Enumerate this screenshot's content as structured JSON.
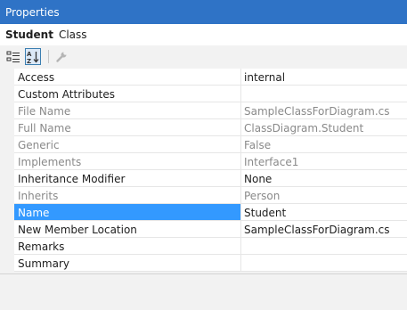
{
  "window": {
    "title": "Properties"
  },
  "object": {
    "name": "Student",
    "kind": "Class"
  },
  "toolbar": {
    "categorized_icon": "categorized-icon",
    "alphabetical_icon": "alphabetical-icon",
    "property_pages_icon": "wrench-icon"
  },
  "properties": [
    {
      "name": "Access",
      "value": "internal",
      "readonly": false,
      "selected": false
    },
    {
      "name": "Custom Attributes",
      "value": "",
      "readonly": false,
      "selected": false
    },
    {
      "name": "File Name",
      "value": "SampleClassForDiagram.cs",
      "readonly": true,
      "selected": false
    },
    {
      "name": "Full Name",
      "value": "ClassDiagram.Student",
      "readonly": true,
      "selected": false
    },
    {
      "name": "Generic",
      "value": "False",
      "readonly": true,
      "selected": false
    },
    {
      "name": "Implements",
      "value": "Interface1",
      "readonly": true,
      "selected": false
    },
    {
      "name": "Inheritance Modifier",
      "value": "None",
      "readonly": false,
      "selected": false
    },
    {
      "name": "Inherits",
      "value": "Person",
      "readonly": true,
      "selected": false
    },
    {
      "name": "Name",
      "value": "Student",
      "readonly": false,
      "selected": true
    },
    {
      "name": "New Member Location",
      "value": "SampleClassForDiagram.cs",
      "readonly": false,
      "selected": false
    },
    {
      "name": "Remarks",
      "value": "",
      "readonly": false,
      "selected": false
    },
    {
      "name": "Summary",
      "value": "",
      "readonly": false,
      "selected": false
    }
  ],
  "colors": {
    "title_bar": "#2f73c6",
    "selection": "#3399ff",
    "readonly_text": "#8a8a8a"
  }
}
